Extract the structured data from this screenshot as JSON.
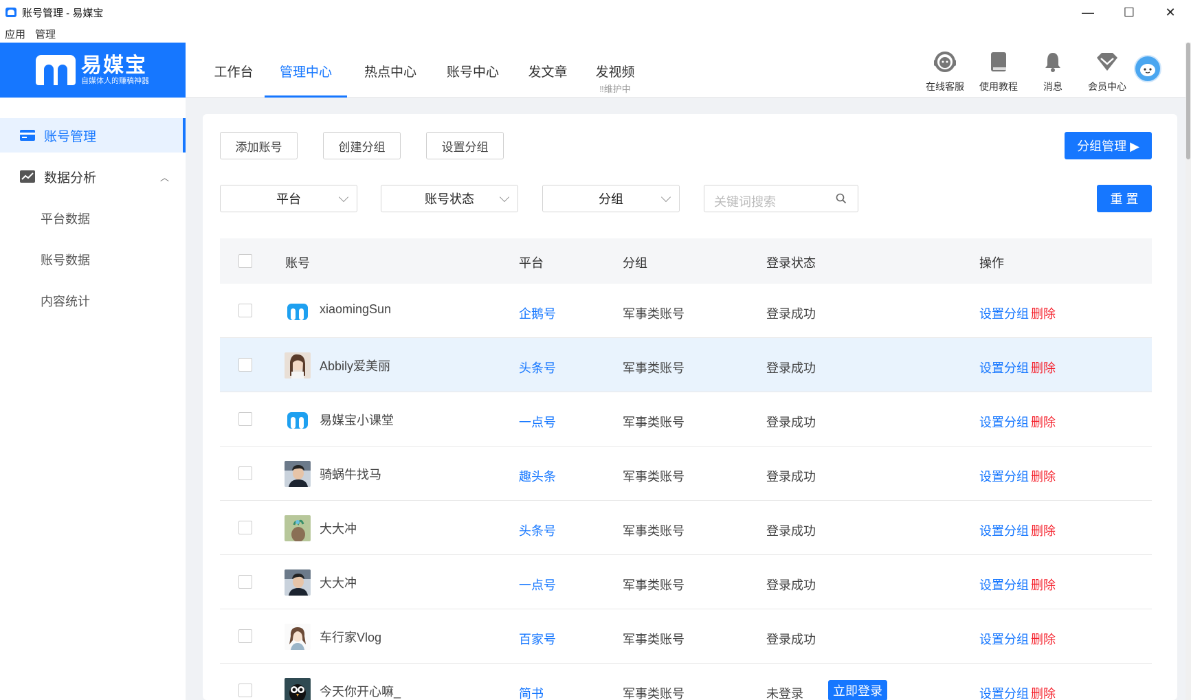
{
  "window": {
    "title": "账号管理 - 易媒宝",
    "minimize": "—",
    "maximize": "☐",
    "close": "✕"
  },
  "menubar": [
    "应用",
    "管理"
  ],
  "logo": {
    "name": "易媒宝",
    "slogan": "自媒体人的赚稿神器"
  },
  "nav": {
    "tabs": [
      {
        "label": "工作台"
      },
      {
        "label": "管理中心",
        "active": true
      },
      {
        "label": "热点中心"
      },
      {
        "label": "账号中心"
      },
      {
        "label": "发文章"
      },
      {
        "label": "发视频",
        "sub": "‼维护中"
      }
    ],
    "tools": [
      {
        "label": "在线客服",
        "icon": "headset-icon"
      },
      {
        "label": "使用教程",
        "icon": "book-icon"
      },
      {
        "label": "消息",
        "icon": "bell-icon"
      },
      {
        "label": "会员中心",
        "icon": "diamond-icon"
      }
    ]
  },
  "sidebar": {
    "items": [
      {
        "label": "账号管理",
        "icon": "card-icon",
        "active": true
      },
      {
        "label": "数据分析",
        "icon": "trend-icon",
        "expanded": true
      }
    ],
    "subitems": [
      "平台数据",
      "账号数据",
      "内容统计"
    ]
  },
  "toolbar": {
    "add": "添加账号",
    "create_group": "创建分组",
    "set_group": "设置分组",
    "group_manage": "分组管理 ▶",
    "reset": "重 置"
  },
  "filters": {
    "platform": "平台",
    "status": "账号状态",
    "group": "分组",
    "search_placeholder": "关键词搜索"
  },
  "table": {
    "headers": {
      "account": "账号",
      "platform": "平台",
      "group": "分组",
      "status": "登录状态",
      "ops": "操作"
    },
    "rows": [
      {
        "name": "xiaomingSun",
        "platform": "企鹅号",
        "group": "军事类账号",
        "status": "登录成功",
        "avatar": "logo"
      },
      {
        "name": "Abbily爱美丽",
        "platform": "头条号",
        "group": "军事类账号",
        "status": "登录成功",
        "avatar": "girl"
      },
      {
        "name": "易媒宝小课堂",
        "platform": "一点号",
        "group": "军事类账号",
        "status": "登录成功",
        "avatar": "logo"
      },
      {
        "name": "骑蜗牛找马",
        "platform": "趣头条",
        "group": "军事类账号",
        "status": "登录成功",
        "avatar": "man"
      },
      {
        "name": "大大冲",
        "platform": "头条号",
        "group": "军事类账号",
        "status": "登录成功",
        "avatar": "plant"
      },
      {
        "name": "大大冲",
        "platform": "一点号",
        "group": "军事类账号",
        "status": "登录成功",
        "avatar": "man"
      },
      {
        "name": "车行家Vlog",
        "platform": "百家号",
        "group": "军事类账号",
        "status": "登录成功",
        "avatar": "cartoon"
      },
      {
        "name": "今天你开心嘛_",
        "platform": "简书",
        "group": "军事类账号",
        "status": "未登录",
        "login_btn": "立即登录",
        "avatar": "owl"
      }
    ],
    "op_set": "设置分组",
    "op_delete": "删除"
  },
  "colors": {
    "accent": "#1677ff",
    "danger": "#f5222d",
    "highlight_row": "#e9f3fd"
  }
}
